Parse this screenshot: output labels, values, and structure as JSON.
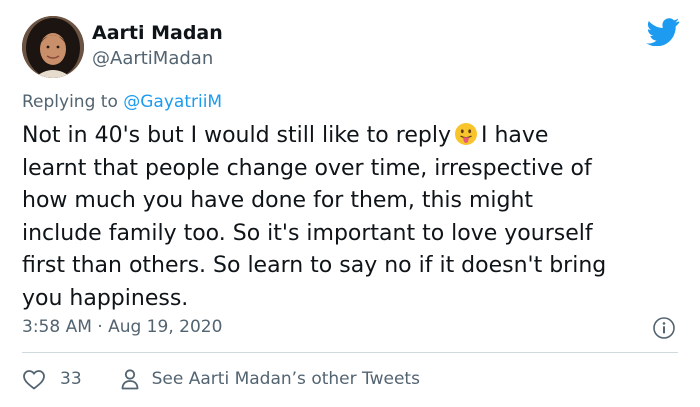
{
  "author": {
    "name": "Aarti Madan",
    "handle": "@AartiMadan"
  },
  "reply": {
    "prefix": "Replying to ",
    "mention": "@GayatriiM"
  },
  "tweet": {
    "text_part1": "Not in 40's but I would still like to reply",
    "emoji": "face-with-tongue-emoji",
    "text_part2": "I have\nlearnt that people change over time, irrespective of\nhow much you have done for them, this might\ninclude family too. So it's important to love yourself\nfirst than others. So learn to say no if it doesn't bring\nyou happiness."
  },
  "meta": {
    "timestamp": "3:58 AM · Aug 19, 2020"
  },
  "actions": {
    "like_count": "33",
    "see_other_label": "See Aarti Madan’s other Tweets"
  },
  "icons": {
    "brand": "twitter-bird-icon",
    "info": "info-icon",
    "like": "heart-icon",
    "profile": "person-icon"
  },
  "colors": {
    "brand_blue": "#1d9bf0",
    "text_primary": "#0f1419",
    "text_secondary": "#536471",
    "divider": "#cfd9de"
  }
}
